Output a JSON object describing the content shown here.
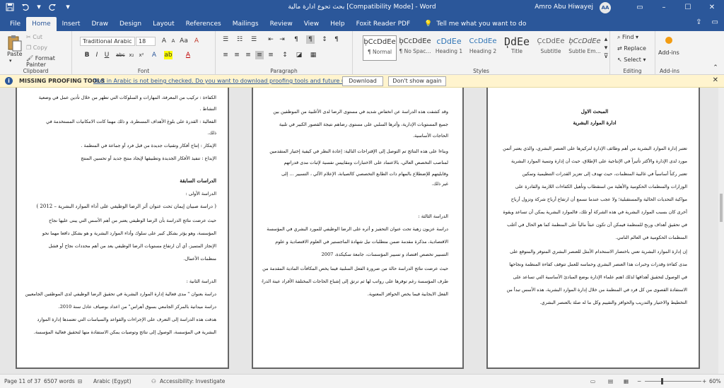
{
  "titlebar": {
    "title": "بحث تحوع ادارة مالية [Compatibility Mode] - Word",
    "user": "Amro Abu Hiwayej",
    "avatar": "AA",
    "quick_icons": [
      "save-icon",
      "undo-icon",
      "redo-icon",
      "customize-icon"
    ],
    "controls": [
      "ribbon-display-icon",
      "minimize-icon",
      "maximize-icon",
      "close-icon"
    ]
  },
  "tabs": {
    "items": [
      "File",
      "Home",
      "Insert",
      "Draw",
      "Design",
      "Layout",
      "References",
      "Mailings",
      "Review",
      "View",
      "Help",
      "Foxit Reader PDF"
    ],
    "active": "Home",
    "tell": "Tell me what you want to do"
  },
  "ribbon": {
    "clipboard": {
      "label": "Clipboard",
      "paste": "Paste",
      "cut": "Cut",
      "copy": "Copy",
      "format_painter": "Format Painter"
    },
    "font": {
      "label": "Font",
      "name": "Traditional Arabic",
      "size": "18"
    },
    "paragraph": {
      "label": "Paragraph"
    },
    "styles": {
      "label": "Styles",
      "items": [
        {
          "sample": "ٖbCcDdEe",
          "name": "¶ Normal"
        },
        {
          "sample": "ٖbCcDdEe",
          "name": "¶ No Spac..."
        },
        {
          "sample": "cDdEe",
          "name": "Heading 1"
        },
        {
          "sample": "CcDdEe",
          "name": "Heading 2"
        },
        {
          "sample": "ٖDdEe",
          "name": "Title"
        },
        {
          "sample": "ٖCcDdEe",
          "name": "Subtitle"
        },
        {
          "sample": "ٖbCcDdEe",
          "name": "Subtle Em..."
        }
      ]
    },
    "editing": {
      "label": "Editing",
      "find": "Find",
      "replace": "Replace",
      "select": "Select"
    },
    "addins": {
      "label": "Add-ins",
      "button": "Add-ins"
    }
  },
  "message": {
    "title": "MISSING PROOFING TOOLS",
    "text": "Text in Arabic is not being checked. Do you want to download proofing tools and future updates?",
    "download": "Download",
    "dont_show": "Don't show again"
  },
  "pages": {
    "left": [
      "الكفاءة : تركيب من المعرفة، المهارات و السلوكات التي تظهر من خلال تأدين عمل في وضعية",
      "النشاط .",
      "الفعالية : القدرة على بلوغ الأهداف المسطرة، و ذلك مهما كانت الامكانيات المستخدمة في",
      "ذلك.",
      "الإبتكار : إنتاج أفكار وتقنيات جديدة من قبل فرد أو جماعة في المنظمة .",
      "الإبداع : تنفيذ الأفكار الجديدة وتطبيقها لإيجاد منتج جديد أو تحسين المنتج",
      "الدراسات السابقة",
      "الدراسة الأولى :",
      "( دراسة صبيان إيمان تحت عنوان أثر الرضا الوظيفي على أداء الموارد البشرية – 2012 )",
      "حيث عرضت نتائج الدراسة بأن الرضا الوظيفي يعتبر من أهم الأسس التي يبنى عليها نجاح",
      "المؤسسة، وهو يؤثر بشكل كبير على سلوك وأداء الموارد البشرية و هو بشكل دافعا مهما نحو",
      "الإنجاز المتميز، أي أن ارتفاع مستويات الرضا الوظيفي يعد من أهم محددات نجاح أو فشل",
      "منظمات الأعمال.",
      "الدراسة الثانية :",
      "دراسة بعنوان \" مدى فعالية إدارة الموارد البشرية في تحقيق الرضا الوظيفي لدى الموظفين الجامعيين",
      "دراسة ميدانية بالمركز الجامعي بسوق أهراس\" من اعداد بوضياف عادل سنة 2010.",
      "هدفت هذه الدراسة إلى التعرف على الإجراءات والقواعد والسياسات التي تعتمدها إدارة الموارد",
      "البشرية في المؤسسة، الوصول إلى نتائج وتوصيات يمكن الاستفادة منها لتحقيق فعالية المؤسسة."
    ],
    "middle": [
      "وقد كشفت هذه الدراسة عن انخفاض شديد في مستوى الرضا لدى الأغلبية من الموظفين بين",
      "جميع المستويات الإدارية، وأثرها السلبي على مستوى رضاهم نتيجة القصور الكبير في تلبية",
      "الحاجات الأساسية.",
      "وبناءا على هذه النتائج تم التوصل إلى الإقتراحات التالية: إعادة النظر في كيفية إختيار المتقدمين",
      "لمناصب التخصص العالي، بالاعتماد على الاختبارات ومقاييس نفسية لإثبات مدى قدراتهم",
      "وقابليتهم للإضطلاع بالمهام ذات الطابع التخصصي كالصيانة، الإعلام الآلي ، التسيير ... إلى",
      "غير ذلك.",
      "الدراسة الثالثة :",
      "دراسة عزيون زهية تحت عنوان التحفيز و أثره على الرضا الوظيفي للمورد البشري في المؤسسة",
      "الاقتصادية، مذكرة مقدمة ضمن متطلبات نيل شهادة الماجستير في العلوم الاقتصادية و علوم",
      "التسيير تخصص اقتصاد و تسيير المؤسسات، جامعة سكيكدة، 2007",
      "حيث عرضت نتائج الدراسة حالة من ضرورة الفعل السلبية فيما يخص المكافآت المادية المقدمة من",
      "طرف المؤسسة رغم توفرها على رواتب لها ثم ترتق إلى إشباع الحاجات المختلفة الأفراد عينة الدراسة، و ردود",
      "الفعل الايجابية فيما يخص الحوافز المعنوية."
    ],
    "right": [
      "المبحث الاول",
      "ادارة الموارد البشرية",
      "تعتبر إدارة الموارد البشرية من أهم وظائف الإدارة لتركيزها على العنصر البشري، والذي يعتبر أثمن",
      "مورد لدى الإدارة والأكثر تأثيراً في الإنتاجية على الإطلاق، حيث أن إدارة وتنمية الموارد البشرية",
      "تعتبر ركناً أساسياً في غالبية المنظمات، حيث تهدف إلى تعزيز القدرات التنظيمية وتمكين",
      "الوزارات والمنظمات الحكومية والأهلية من استقطاب وتأهيل الكفاءات اللازمة والقادرة على",
      "مواكبة التحديات الحالية والمستقبلية؛ ولا عجب عندما نسمع أن ارتفاع أرباح شركة وتزول أرباح",
      "أخرى كان بسبب الموارد البشرية في هذه الشركة أو تلك، فالموارد البشرية يمكن أن تساعد ويقوة",
      "في تحقيق أهداف وربح للمنظمة فيمكن أن تكون عبئاً مالياً على المنظمة كما هو الحال في أغلب",
      "المنظمات الحكومية في العالم النامي.",
      "إن إدارة الموارد البشرية تعني باختصار الاستخدام الأمثل للعنصر البشري المتوفر والمتوقع على",
      "مدى كفاءة وقدرات وخبرات هذا العنصر البشري وحماسه للعمل تتوقف كفاءة المنظمة ونجاحها",
      "في الوصول لتحقيق أهدافها لذلك اهتم علماء الإدارة بوضع المبادئ الأساسية التي تساعد على",
      "الاستفادة القصوى من كل فرد في المنظمة من خلال إدارة الموارد البشرية، هذه الأسس تبدأ من",
      "التخطيط والاختيار والتدريب والحوافز والتقييم وكل ما له صلة بالعنصر البشري."
    ]
  },
  "status": {
    "page": "Page 11 of 37",
    "words": "6507 words",
    "language": "Arabic (Egypt)",
    "accessibility": "Accessibility: Investigate",
    "zoom": "60%",
    "zoom_level": 0.6
  }
}
